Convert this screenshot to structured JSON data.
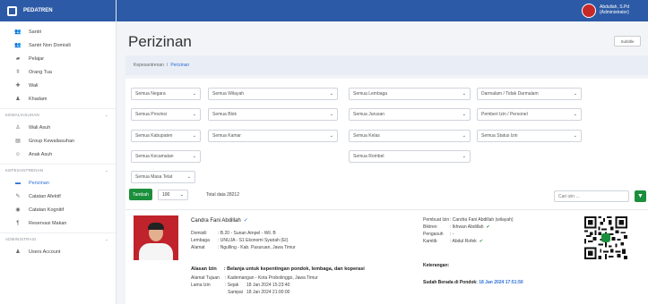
{
  "app": {
    "name": "PEDATREN"
  },
  "user": {
    "name": "Abdullah, S.Pd",
    "role": "(Administrator)"
  },
  "sidebar": {
    "items_top": [
      {
        "label": "Santri",
        "icon": "users-icon"
      },
      {
        "label": "Santri Non Domisili",
        "icon": "users-icon"
      },
      {
        "label": "Pelajar",
        "icon": "graduation-icon"
      },
      {
        "label": "Orang Tua",
        "icon": "parents-icon"
      },
      {
        "label": "Wali",
        "icon": "user-shield-icon"
      },
      {
        "label": "Khadam",
        "icon": "user-icon"
      }
    ],
    "section_1": "KEWALIASUHAN",
    "items_1": [
      {
        "label": "Wali Asuh",
        "icon": "user-tie-icon"
      },
      {
        "label": "Group Kewaliasuhan",
        "icon": "group-icon"
      },
      {
        "label": "Anak Asuh",
        "icon": "child-icon"
      }
    ],
    "section_2": "KEPESANTRENAN",
    "items_2": [
      {
        "label": "Perizinan",
        "icon": "id-card-icon"
      },
      {
        "label": "Catatan Afektif",
        "icon": "note-icon"
      },
      {
        "label": "Catatan Kognitif",
        "icon": "note-icon"
      },
      {
        "label": "Reservasi Makan",
        "icon": "utensils-icon"
      }
    ],
    "section_3": "ADMINISTRASI",
    "items_3": [
      {
        "label": "Users Account",
        "icon": "user-icon"
      }
    ]
  },
  "page": {
    "title": "Perizinan",
    "subtitle_button": "Subtitle"
  },
  "breadcrumb": {
    "parent": "Kepesantrenan",
    "separator": "/",
    "current": "Perizinan"
  },
  "filters": {
    "negara": "Semua Negara",
    "wilayah": "Semua Wilayah",
    "lembaga": "Semua Lembaga",
    "darmalam": "Darmalam / Tidak Darmalam",
    "provinsi": "Semua Provinsi",
    "blok": "Semua Blok",
    "jurusan": "Semua Jurusan",
    "pemberi": "Pemberi Izin / Personel",
    "kabupaten": "Semua Kabupaten",
    "kamar": "Semua Kamar",
    "kelas": "Semua Kelas",
    "status_izin": "Semua Status Izin",
    "kecamatan": "Semua Kecamatan",
    "rombel": "Semua Rombel",
    "masa_telat": "Semua Masa Telat"
  },
  "toolbar": {
    "add_label": "Tambah",
    "per_page": "100",
    "total": "Total data 28212",
    "search_placeholder": "Cari izin ..."
  },
  "record": {
    "name": "Candra Fani Abdillah",
    "domisili_label": "Domisili",
    "domisili": ": B.20 - Sunan Ampel - Wil. B",
    "lembaga_label": "Lembaga",
    "lembaga": ": UNUJA - S1 Ekonomi Syariah (EI)",
    "alamat_label": "Alamat",
    "alamat": ": Ngulling - Kab. Pasuruan, Jawa Timur",
    "alasan_label": "Alasan Izin",
    "alasan": ": Belanja untuk kepentingan pondok, lembaga, dan koperasi",
    "tujuan_label": "Alamat Tujuan",
    "tujuan": ": Kademangan - Kota Probolinggo, Jawa Timur",
    "lama_label": "Lama Izin",
    "sejak_label": ": Sejak",
    "sejak": "18 Jan 2024 15:23:40",
    "sampai_label": "Sampai",
    "sampai": "18 Jan 2024 21:00:00",
    "pembuat_label": "Pembuat Izin",
    "pembuat": ": Candra Fani Abdillah (wilayah)",
    "biktren_label": "Biktren",
    "biktren": ": Ikhwan Abdillah",
    "pengasuh_label": "Pengasuh",
    "pengasuh": ": -",
    "kamtib_label": "Kamtib",
    "kamtib": ": Abdul Rofek",
    "keterangan_label": "Keterangan:",
    "sudah_label": "Sudah Berada di Pondok:",
    "sudah": "18 Jan 2024 17:51:50"
  }
}
